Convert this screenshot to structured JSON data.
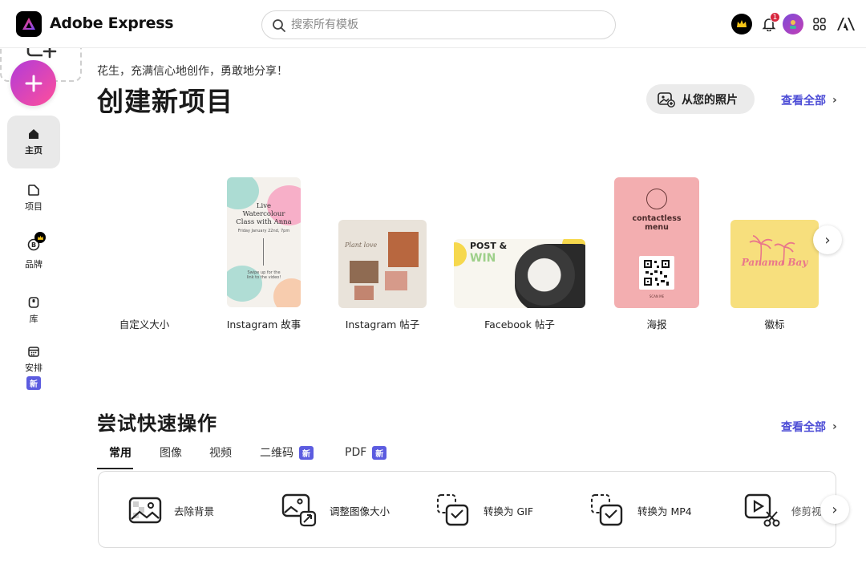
{
  "app": {
    "name": "Adobe Express"
  },
  "search": {
    "placeholder": "搜索所有模板"
  },
  "notifications": {
    "count": "1"
  },
  "sidebar": {
    "items": [
      {
        "label": "主页",
        "icon": "home-icon"
      },
      {
        "label": "项目",
        "icon": "project-icon"
      },
      {
        "label": "品牌",
        "icon": "brand-icon"
      },
      {
        "label": "库",
        "icon": "library-icon"
      },
      {
        "label": "安排",
        "icon": "calendar-icon",
        "badge": "新"
      }
    ]
  },
  "main": {
    "greeting": "花生，充满信心地创作，勇敢地分享！",
    "title": "创建新项目",
    "photo_button": "从您的照片",
    "view_all": "查看全部",
    "templates": [
      {
        "label": "自定义大小"
      },
      {
        "label": "Instagram 故事",
        "text": [
          "Live",
          "Watercolour",
          "Class with Anna",
          "Friday January 22nd, 7pm",
          "Swipe up for the",
          "link to the video!"
        ]
      },
      {
        "label": "Instagram 帖子",
        "text": "Plant love"
      },
      {
        "label": "Facebook 帖子",
        "text": [
          "POST &",
          "WIN"
        ]
      },
      {
        "label": "海报",
        "text": [
          "contactless",
          "menu",
          "SCAN ME"
        ]
      },
      {
        "label": "徽标",
        "text": "Panama Bay"
      }
    ]
  },
  "quick_actions": {
    "title": "尝试快速操作",
    "view_all": "查看全部",
    "tabs": [
      {
        "label": "常用",
        "active": true
      },
      {
        "label": "图像"
      },
      {
        "label": "视频"
      },
      {
        "label": "二维码",
        "badge": "新"
      },
      {
        "label": "PDF",
        "badge": "新"
      }
    ],
    "items": [
      {
        "label": "去除背景",
        "icon": "remove-background-icon"
      },
      {
        "label": "调整图像大小",
        "icon": "resize-image-icon"
      },
      {
        "label": "转换为 GIF",
        "icon": "convert-gif-icon"
      },
      {
        "label": "转换为 MP4",
        "icon": "convert-mp4-icon"
      },
      {
        "label": "修剪视",
        "icon": "trim-video-icon"
      }
    ]
  },
  "colors": {
    "accent": "#4d4dd6",
    "new_badge": "#5c5ce0",
    "create_gradient_start": "#b13bd9",
    "create_gradient_end": "#ff4f9b"
  }
}
